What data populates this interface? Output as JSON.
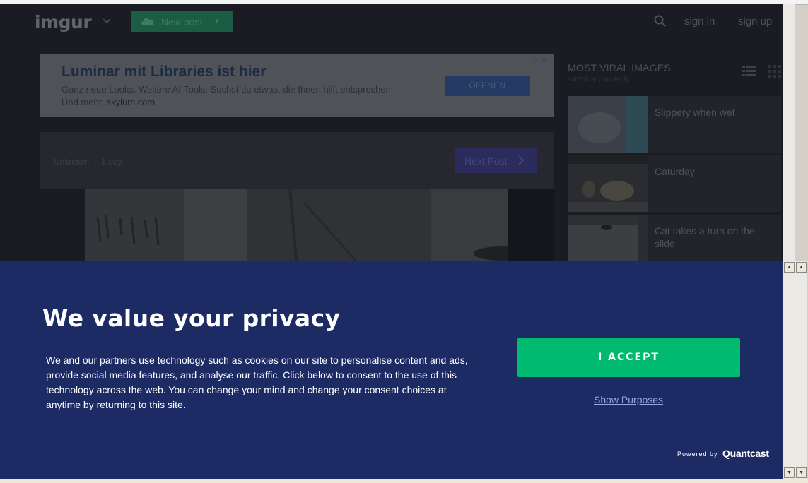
{
  "header": {
    "logo": "imgur",
    "new_post_label": "New post",
    "sign_in": "sign in",
    "sign_up": "sign up"
  },
  "ad": {
    "title": "Luminar mit Libraries ist hier",
    "body": "Ganz neue Looks. Weitere AI-Tools. Suchst du etwas, die Ihnen hilft entsprechen",
    "body_line2": "Und mehr.",
    "link": "skylum.com",
    "button_label": "ÖFFNEN"
  },
  "post": {
    "author": "Unknown",
    "age": "1 day",
    "next_post_label": "Next Post"
  },
  "sidebar": {
    "title": "MOST VIRAL IMAGES",
    "subtitle": "sorted by popularity",
    "items": [
      {
        "title": "Slippery when wet"
      },
      {
        "title": "Caturday"
      },
      {
        "title": "Cat takes a turn on the slide"
      }
    ]
  },
  "consent": {
    "title": "We value your privacy",
    "text": "We and our partners use technology such as cookies on our site to personalise content and ads, provide social media features, and analyse our traffic. Click below to consent to the use of this technology across the web. You can change your mind and change your consent choices at anytime by returning to this site.",
    "accept_label": "I ACCEPT",
    "show_purposes_label": "Show Purposes",
    "powered_by": "Powered by",
    "brand": "Quantcast"
  },
  "colors": {
    "page_bg": "#1b1c23",
    "consent_bg": "#1d2b64",
    "accept_green": "#00bb6f",
    "link_color": "#9ba5e0"
  },
  "icons": [
    "chevron-down-icon",
    "upload-cloud-icon",
    "search-icon",
    "list-view-icon",
    "grid-view-icon",
    "chevron-right-icon",
    "adchoices-icon",
    "close-icon"
  ]
}
